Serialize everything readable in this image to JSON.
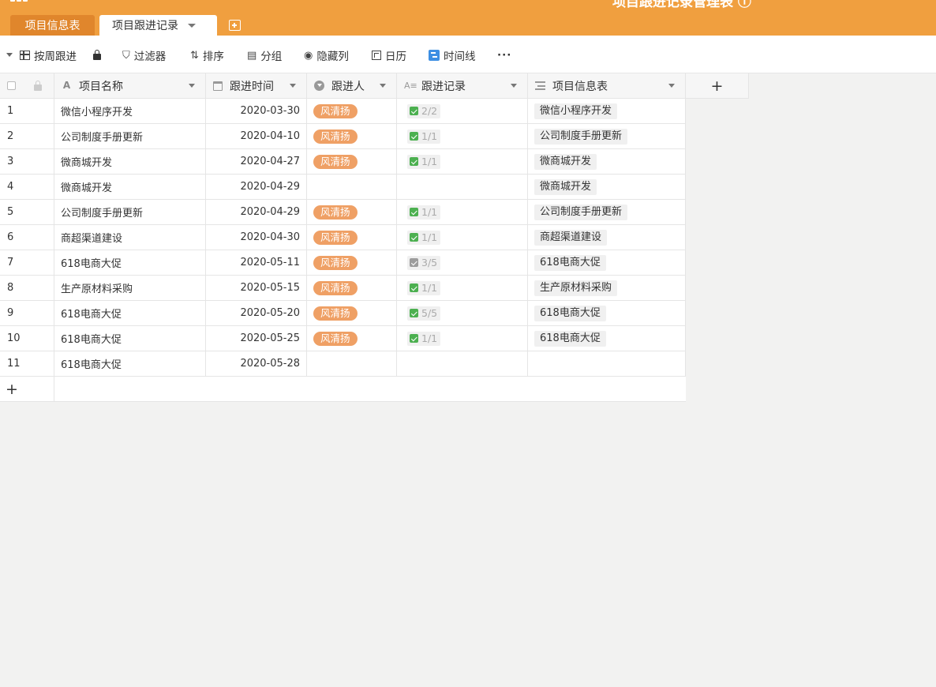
{
  "header": {
    "app_title": "项目跟进记录管理表 ⓘ",
    "tabs": [
      {
        "label": "项目信息表"
      },
      {
        "label": "项目跟进记录"
      }
    ]
  },
  "toolbar": {
    "view": "按周跟进",
    "filter": "过滤器",
    "sort": "排序",
    "group": "分组",
    "hide_cols": "隐藏列",
    "calendar": "日历",
    "timeline": "时间线",
    "more": "···"
  },
  "columns": [
    {
      "label": "项目名称",
      "icon": "text-type-icon"
    },
    {
      "label": "跟进时间",
      "icon": "date-icon"
    },
    {
      "label": "跟进人",
      "icon": "person-icon"
    },
    {
      "label": "跟进记录",
      "icon": "longtext-icon"
    },
    {
      "label": "项目信息表",
      "icon": "link-icon"
    }
  ],
  "colors": {
    "brand": "#f09f3f",
    "tab_active_dark": "#e0862c",
    "person_tag": "#efa065",
    "check_green": "#4cb050"
  },
  "rows": [
    {
      "no": "1",
      "name": "微信小程序开发",
      "date": "2020-03-30",
      "person": "风清扬",
      "record": "2/2",
      "record_done": true,
      "link": "微信小程序开发"
    },
    {
      "no": "2",
      "name": "公司制度手册更新",
      "date": "2020-04-10",
      "person": "风清扬",
      "record": "1/1",
      "record_done": true,
      "link": "公司制度手册更新"
    },
    {
      "no": "3",
      "name": "微商城开发",
      "date": "2020-04-27",
      "person": "风清扬",
      "record": "1/1",
      "record_done": true,
      "link": "微商城开发"
    },
    {
      "no": "4",
      "name": "微商城开发",
      "date": "2020-04-29",
      "person": "",
      "record": "",
      "record_done": false,
      "link": "微商城开发"
    },
    {
      "no": "5",
      "name": "公司制度手册更新",
      "date": "2020-04-29",
      "person": "风清扬",
      "record": "1/1",
      "record_done": true,
      "link": "公司制度手册更新"
    },
    {
      "no": "6",
      "name": "商超渠道建设",
      "date": "2020-04-30",
      "person": "风清扬",
      "record": "1/1",
      "record_done": true,
      "link": "商超渠道建设"
    },
    {
      "no": "7",
      "name": "618电商大促",
      "date": "2020-05-11",
      "person": "风清扬",
      "record": "3/5",
      "record_done": false,
      "link": "618电商大促"
    },
    {
      "no": "8",
      "name": "生产原材料采购",
      "date": "2020-05-15",
      "person": "风清扬",
      "record": "1/1",
      "record_done": true,
      "link": "生产原材料采购"
    },
    {
      "no": "9",
      "name": "618电商大促",
      "date": "2020-05-20",
      "person": "风清扬",
      "record": "5/5",
      "record_done": true,
      "link": "618电商大促"
    },
    {
      "no": "10",
      "name": "618电商大促",
      "date": "2020-05-25",
      "person": "风清扬",
      "record": "1/1",
      "record_done": true,
      "link": "618电商大促"
    },
    {
      "no": "11",
      "name": "618电商大促",
      "date": "2020-05-28",
      "person": "",
      "record": "",
      "record_done": false,
      "link": ""
    }
  ]
}
